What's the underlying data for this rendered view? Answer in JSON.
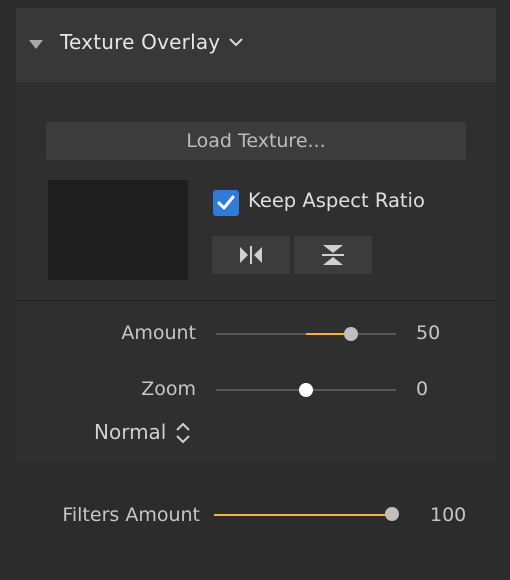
{
  "texture_overlay": {
    "title": "Texture Overlay",
    "load_button_label": "Load Texture...",
    "keep_aspect_ratio": {
      "label": "Keep Aspect Ratio",
      "checked": true
    },
    "amount": {
      "label": "Amount",
      "value": "50",
      "slider_min": -100,
      "slider_max": 100,
      "slider_value": 50
    },
    "zoom": {
      "label": "Zoom",
      "value": "0",
      "slider_min": -100,
      "slider_max": 100,
      "slider_value": 0
    },
    "blend_mode": "Normal"
  },
  "filters_amount": {
    "label": "Filters Amount",
    "value": "100",
    "slider_min": 0,
    "slider_max": 100,
    "slider_value": 100
  },
  "colors": {
    "accent": "#f0b33c",
    "checkbox": "#2f7bd9",
    "knob": "#bfbfbf",
    "knob_active": "#ffffff"
  }
}
